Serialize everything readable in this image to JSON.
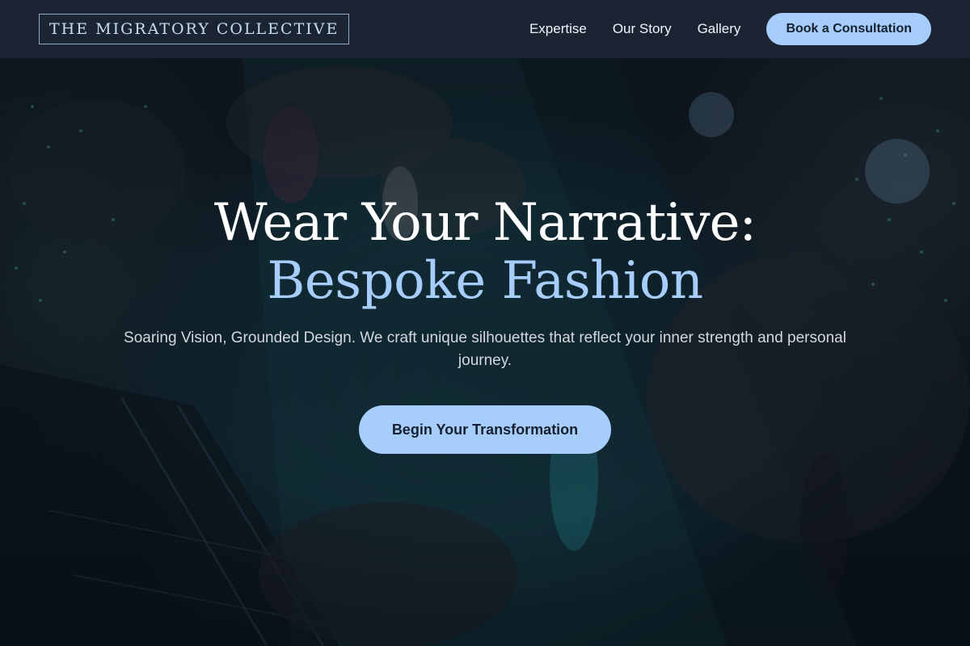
{
  "navbar": {
    "brand": "THE MIGRATORY COLLECTIVE",
    "links": [
      {
        "label": "Expertise"
      },
      {
        "label": "Our Story"
      },
      {
        "label": "Gallery"
      }
    ],
    "cta_label": "Book a Consultation"
  },
  "hero": {
    "headline_line1": "Wear Your Narrative:",
    "headline_line2": "Bespoke Fashion",
    "subtext": "Soaring Vision, Grounded Design. We craft unique silhouettes that reflect your inner strength and personal journey.",
    "cta_label": "Begin Your Transformation",
    "background_image": "fashion-runway-photo"
  },
  "colors": {
    "nav_background": "#1b2433",
    "accent": "#a6cdfb",
    "brand_text": "#c9dcf2",
    "headline_white": "#ffffff",
    "button_text": "#16202e"
  }
}
